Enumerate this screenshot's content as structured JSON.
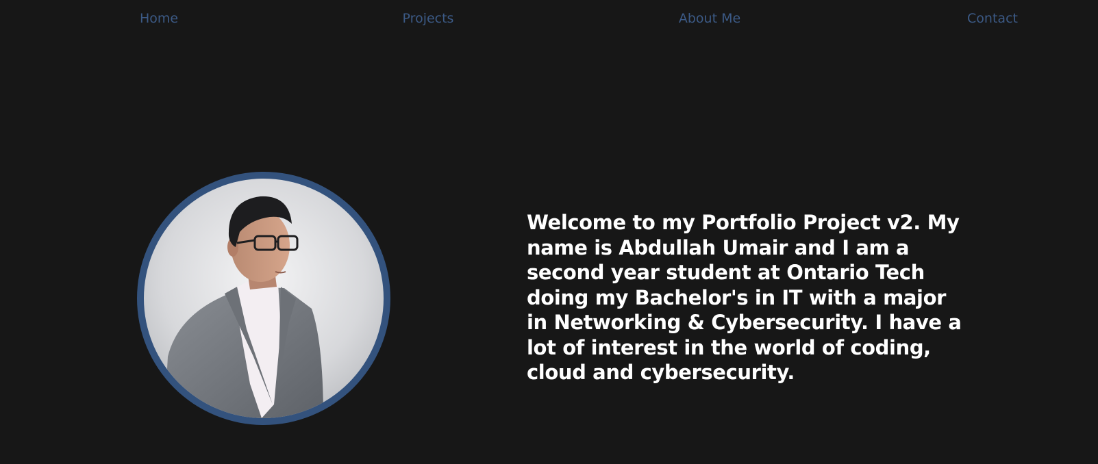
{
  "nav": {
    "items": [
      {
        "label": "Home"
      },
      {
        "label": "Projects"
      },
      {
        "label": "About Me"
      },
      {
        "label": "Contact"
      }
    ]
  },
  "hero": {
    "intro": "Welcome to my Portfolio Project v2. My name is Abdullah Umair and I am a second year student at Ontario Tech doing my Bachelor's in IT with a major in Networking & Cybersecurity. I have a lot of interest in the world of coding, cloud and cybersecurity."
  },
  "colors": {
    "background": "#171717",
    "nav_link": "#3c5a86",
    "avatar_ring": "#33527d",
    "text": "#ffffff"
  }
}
